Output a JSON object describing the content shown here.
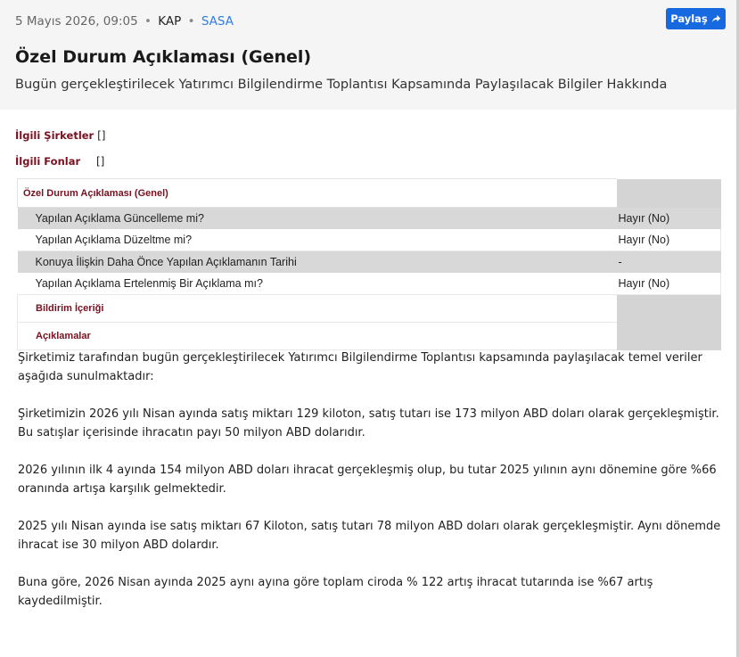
{
  "header": {
    "date": "5 Mayıs 2026, 09:05",
    "separator": "•",
    "source": "KAP",
    "ticker": "SASA",
    "share_label": "Paylaş",
    "title": "Özel Durum Açıklaması (Genel)",
    "subtitle": "Bugün gerçekleştirilecek Yatırımcı Bilgilendirme Toplantısı Kapsamında Paylaşılacak Bilgiler Hakkında"
  },
  "related": {
    "companies_label": "İlgili Şirketler",
    "companies_value": "[]",
    "funds_label": "İlgili Fonlar",
    "funds_value": "[]"
  },
  "table": {
    "heading": "Özel Durum Açıklaması (Genel)",
    "rows": [
      {
        "q": "Yapılan Açıklama Güncelleme mi?",
        "a": "Hayır (No)"
      },
      {
        "q": "Yapılan Açıklama Düzeltme mi?",
        "a": "Hayır (No)"
      },
      {
        "q": "Konuya İlişkin Daha Önce Yapılan Açıklamanın Tarihi",
        "a": "-"
      },
      {
        "q": "Yapılan Açıklama Ertelenmiş Bir Açıklama mı?",
        "a": "Hayır (No)"
      }
    ],
    "section1": "Bildirim İçeriği",
    "section2": "Açıklamalar"
  },
  "body": [
    "Şirketimiz tarafından bugün gerçekleştirilecek Yatırımcı Bilgilendirme Toplantısı kapsamında paylaşılacak temel veriler aşağıda sunulmaktadır:",
    "Şirketimizin 2026 yılı Nisan ayında satış miktarı 129 kiloton, satış tutarı ise 173 milyon ABD doları olarak gerçekleşmiştir. Bu satışlar içerisinde ihracatın payı 50 milyon ABD dolarıdır.",
    "2026 yılının ilk 4 ayında 154 milyon ABD doları ihracat gerçekleşmiş olup,  bu tutar 2025 yılının aynı dönemine göre %66 oranında artışa karşılık gelmektedir.",
    "2025 yılı Nisan ayında ise satış miktarı 67 Kiloton, satış tutarı 78 milyon ABD doları olarak gerçekleşmiştir. Aynı dönemde ihracat ise 30 milyon ABD dolardır.",
    "Buna göre, 2026 Nisan ayında 2025 aynı ayına göre toplam ciroda % 122 artış ihracat tutarında ise %67 artış kaydedilmiştir."
  ]
}
